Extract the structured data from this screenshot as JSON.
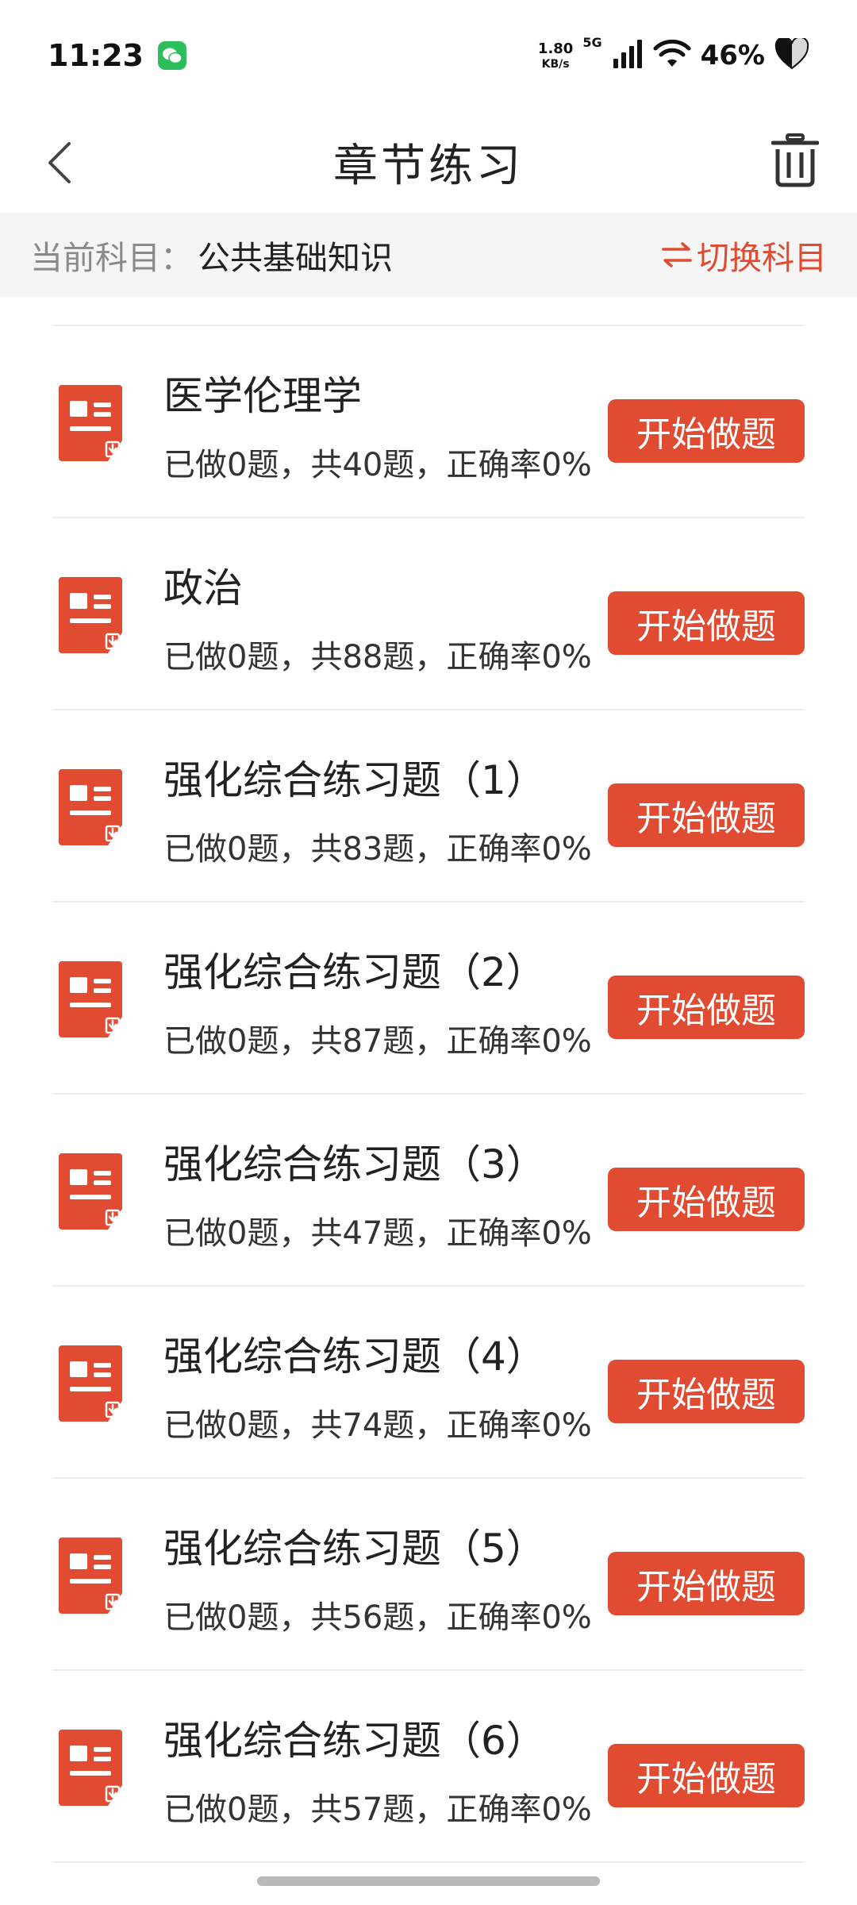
{
  "status_bar": {
    "time": "11:23",
    "net_speed_value": "1.80",
    "net_speed_unit": "KB/s",
    "signal_label": "5G",
    "battery": "46%"
  },
  "header": {
    "title": "章节练习"
  },
  "subject_bar": {
    "label": "当前科目：",
    "value": "公共基础知识",
    "switch_label": "切换科目"
  },
  "colors": {
    "accent": "#e04b32",
    "subject_bg": "#f5f5f5",
    "divider": "#eeeeee"
  },
  "start_label": "开始做题",
  "chapters": [
    {
      "title": "医学伦理学",
      "stats": "已做0题，共40题，正确率0%"
    },
    {
      "title": "政治",
      "stats": "已做0题，共88题，正确率0%"
    },
    {
      "title": "强化综合练习题（1）",
      "stats": "已做0题，共83题，正确率0%"
    },
    {
      "title": "强化综合练习题（2）",
      "stats": "已做0题，共87题，正确率0%"
    },
    {
      "title": "强化综合练习题（3）",
      "stats": "已做0题，共47题，正确率0%"
    },
    {
      "title": "强化综合练习题（4）",
      "stats": "已做0题，共74题，正确率0%"
    },
    {
      "title": "强化综合练习题（5）",
      "stats": "已做0题，共56题，正确率0%"
    },
    {
      "title": "强化综合练习题（6）",
      "stats": "已做0题，共57题，正确率0%"
    }
  ]
}
